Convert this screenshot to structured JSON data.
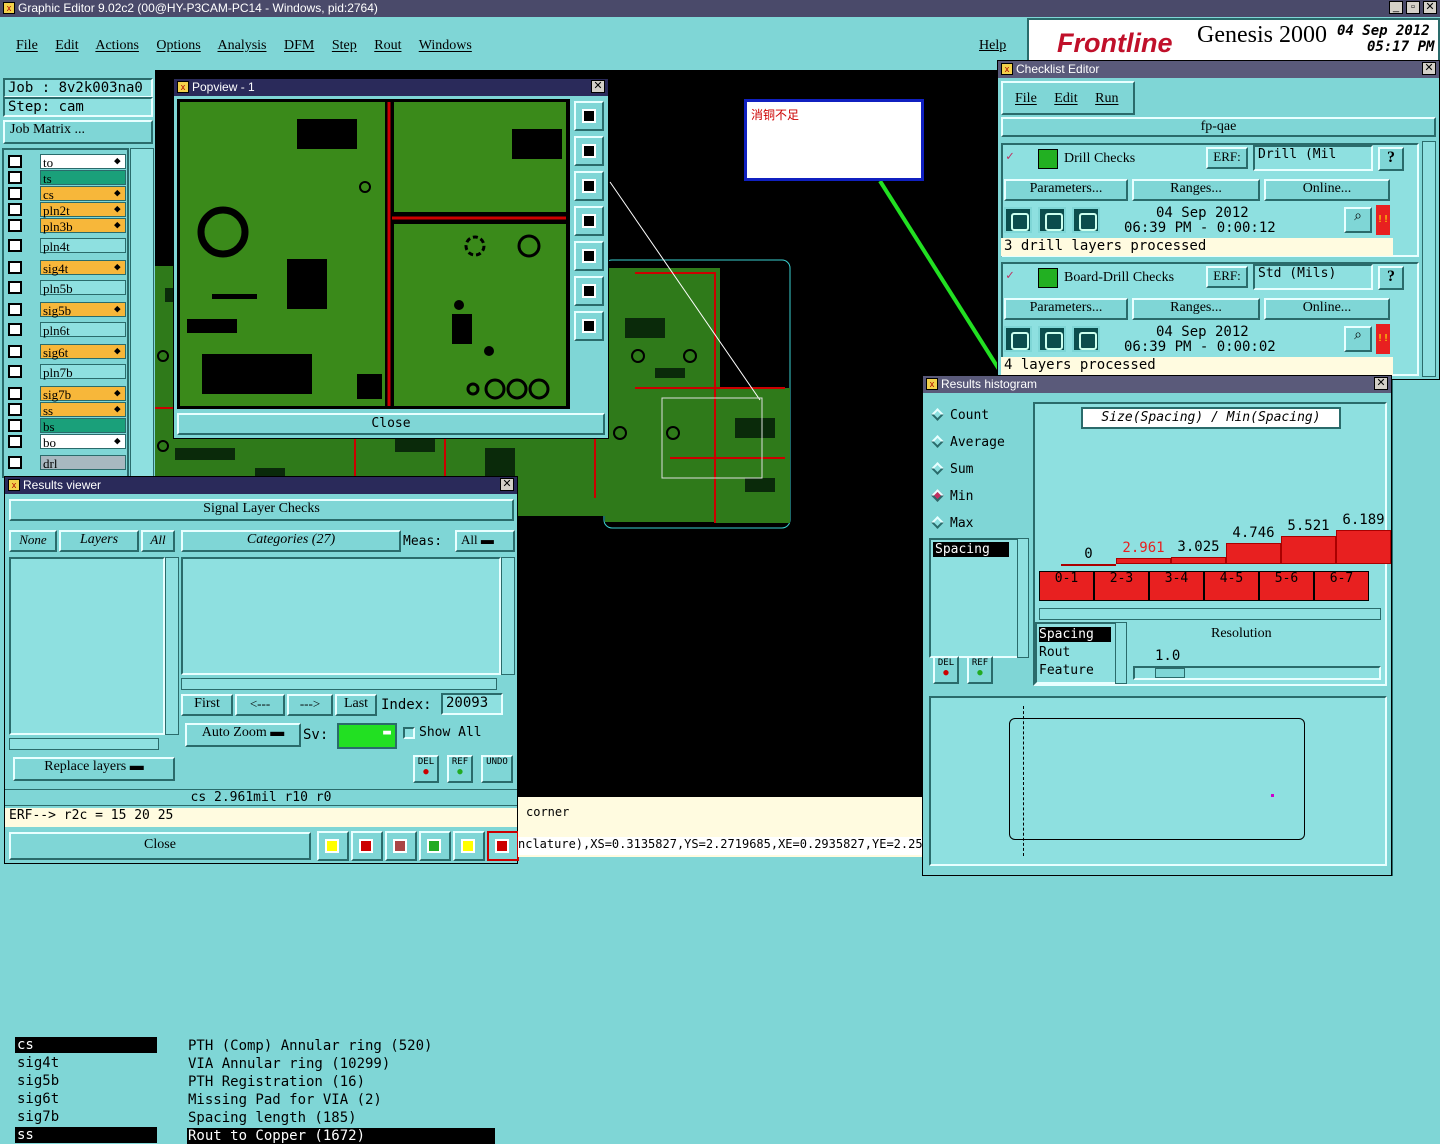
{
  "window_title": "Graphic Editor 9.02c2 (00@HY-P3CAM-PC14 - Windows, pid:2764)",
  "menu": [
    "File",
    "Edit",
    "Actions",
    "Options",
    "Analysis",
    "DFM",
    "Step",
    "Rout",
    "Windows"
  ],
  "help": "Help",
  "brand": {
    "logo": "Frontline",
    "product": "Genesis 2000",
    "date": "04 Sep 2012",
    "time": "05:17 PM"
  },
  "job": {
    "job_label": "Job : 8v2k003na0",
    "step_label": "Step: cam",
    "matrix_button": "Job Matrix ..."
  },
  "layers": [
    {
      "name": "to",
      "color": "#ffffff",
      "mark": true
    },
    {
      "name": "ts",
      "color": "#1aa07a",
      "mark": false
    },
    {
      "name": "cs",
      "color": "#f7b73a",
      "mark": true
    },
    {
      "name": "pln2t",
      "color": "#f7b73a",
      "mark": true
    },
    {
      "name": "pln3b",
      "color": "#f7b73a",
      "mark": true
    },
    {
      "name": "pln4t",
      "color": "#8ee0e0",
      "mark": false
    },
    {
      "name": "sig4t",
      "color": "#f7b73a",
      "mark": true
    },
    {
      "name": "pln5b",
      "color": "#8ee0e0",
      "mark": false
    },
    {
      "name": "sig5b",
      "color": "#f7b73a",
      "mark": true
    },
    {
      "name": "pln6t",
      "color": "#8ee0e0",
      "mark": false
    },
    {
      "name": "sig6t",
      "color": "#f7b73a",
      "mark": true
    },
    {
      "name": "pln7b",
      "color": "#8ee0e0",
      "mark": false
    },
    {
      "name": "sig7b",
      "color": "#f7b73a",
      "mark": true
    },
    {
      "name": "ss",
      "color": "#f7b73a",
      "mark": true
    },
    {
      "name": "bs",
      "color": "#1aa07a",
      "mark": false
    },
    {
      "name": "bo",
      "color": "#ffffff",
      "mark": true
    },
    {
      "name": "drl",
      "color": "#a8b8c0",
      "mark": false
    }
  ],
  "popview": {
    "title": "Popview - 1",
    "close": "Close"
  },
  "note": {
    "text": "消铜不足"
  },
  "results_viewer": {
    "title": "Results viewer",
    "header": "Signal Layer Checks",
    "none": "None",
    "layers": "Layers",
    "all": "All",
    "categories": "Categories (27)",
    "meas": "Meas:",
    "meas_value": "All",
    "layer_list": [
      "cs",
      "sig4t",
      "sig5b",
      "sig6t",
      "sig7b",
      "ss"
    ],
    "category_list": [
      "PTH (Comp) Annular ring (520)",
      "VIA Annular ring (10299)",
      "PTH Registration (16)",
      "Missing Pad for VIA (2)",
      "Spacing length (185)",
      "Rout to Copper (1672)"
    ],
    "first": "First",
    "prev": "<---",
    "next": "--->",
    "last": "Last",
    "index_label": "Index:",
    "index_value": "20093",
    "auto_zoom": "Auto Zoom",
    "sv": "Sv:",
    "show_all": "Show All",
    "replace_layers": "Replace layers",
    "status1": "cs 2.961mil  r10  r0",
    "status2": "ERF--> r2c = 15 20 25",
    "close": "Close",
    "icons": {
      "del": "DEL",
      "ref": "REF",
      "undo": "UNDO"
    }
  },
  "bottom_status": {
    "corner": "corner",
    "coords": "nclature),XS=0.3135827,YS=2.2719685,XE=0.2935827,YE=2.251"
  },
  "checklist": {
    "title": "Checklist Editor",
    "menu": [
      "File",
      "Edit",
      "Run"
    ],
    "name": "fp-qae",
    "checks": [
      {
        "name": "Drill Checks",
        "erf_label": "ERF:",
        "erf_value": "Drill (Mil",
        "params": "Parameters...",
        "ranges": "Ranges...",
        "online": "Online...",
        "date": "04 Sep 2012",
        "time": "06:39 PM - 0:00:12",
        "status": "3 drill layers processed"
      },
      {
        "name": "Board-Drill Checks",
        "erf_label": "ERF:",
        "erf_value": "Std (Mils)",
        "params": "Parameters...",
        "ranges": "Ranges...",
        "online": "Online...",
        "date": "04 Sep 2012",
        "time": "06:39 PM - 0:00:02",
        "status": "4 layers processed"
      }
    ],
    "help_q": "?",
    "side_text": "ch"
  },
  "histogram": {
    "title": "Results histogram",
    "modes": [
      {
        "label": "Count",
        "on": false
      },
      {
        "label": "Average",
        "on": false
      },
      {
        "label": "Sum",
        "on": false
      },
      {
        "label": "Min",
        "on": true
      },
      {
        "label": "Max",
        "on": false
      }
    ],
    "plot_title": "Size(Spacing) / Min(Spacing)",
    "list_top": [
      "Spacing"
    ],
    "list_bottom": [
      "Spacing",
      "Rout",
      "Feature"
    ],
    "resolution_label": "Resolution",
    "resolution_value": "1.0",
    "del": "DEL",
    "ref": "REF"
  },
  "chart_data": {
    "type": "bar",
    "title": "Size(Spacing) / Min(Spacing)",
    "categories": [
      "0-1",
      "2-3",
      "3-4",
      "4-5",
      "5-6",
      "6-7"
    ],
    "values": [
      0,
      2.961,
      3.025,
      4.746,
      5.521,
      6.189
    ],
    "value_labels": [
      "0",
      "2.961",
      "3.025",
      "4.746",
      "5.521",
      "6.189"
    ],
    "highlight_color": "#e82020",
    "xlabel": "",
    "ylabel": ""
  },
  "colors": {
    "bg": "#7fd6d6",
    "canvas": "#000000",
    "pcb_green": "#3a8a1a",
    "pcb_dark": "#0a3a0a",
    "arrow": "#22e022",
    "bar": "#e82020",
    "title": "#4a4a6a"
  }
}
